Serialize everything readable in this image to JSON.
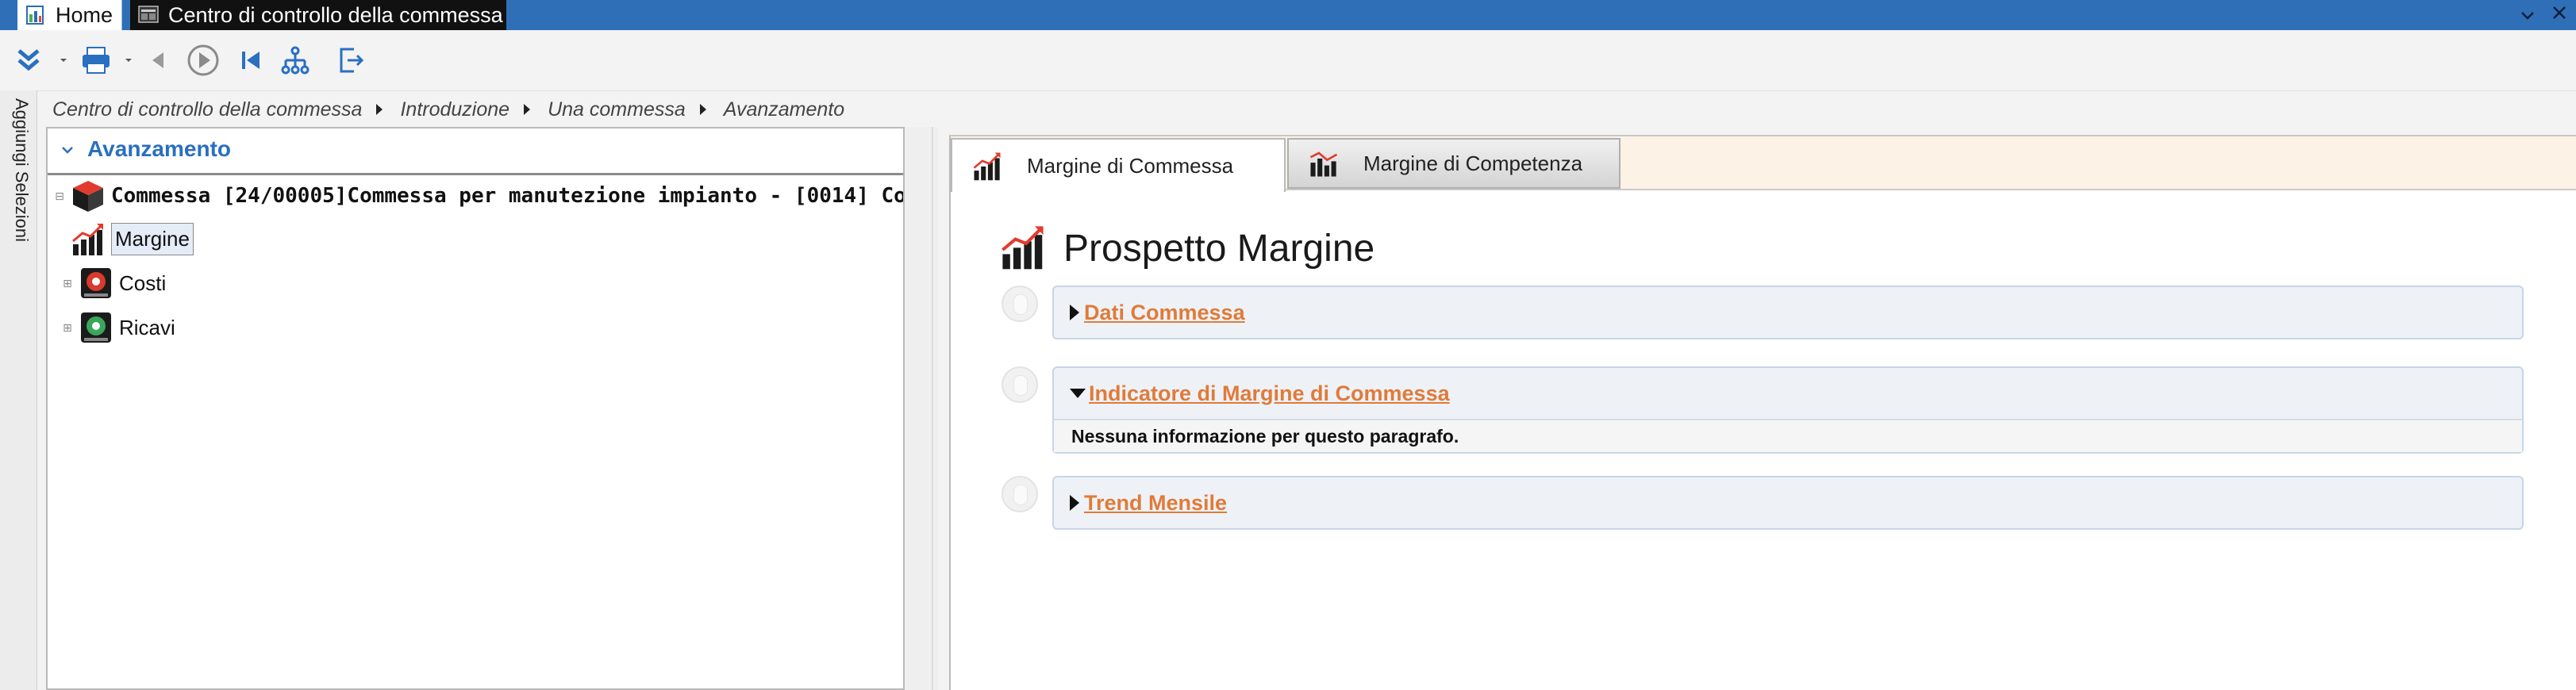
{
  "titlebar": {
    "tabs": [
      {
        "label": "Home",
        "icon": "home-app-icon"
      },
      {
        "label": "Centro di controllo della commessa",
        "icon": "control-center-icon"
      }
    ],
    "controls": [
      "chevron-down-icon",
      "close-icon"
    ],
    "color": "#2e6fb7"
  },
  "toolbar": {
    "buttons": [
      {
        "name": "collapse-button",
        "icon": "double-chevron-down-icon"
      },
      {
        "name": "print-button",
        "icon": "printer-icon"
      },
      {
        "name": "back-button",
        "icon": "triangle-left-icon"
      },
      {
        "name": "play-button",
        "icon": "play-circle-icon"
      },
      {
        "name": "first-button",
        "icon": "skip-first-icon"
      },
      {
        "name": "hierarchy-button",
        "icon": "hierarchy-icon"
      },
      {
        "name": "exit-button",
        "icon": "exit-icon"
      }
    ]
  },
  "sidebar": {
    "vertical_label": "Aggiungi Selezioni"
  },
  "breadcrumb": {
    "items": [
      "Centro di controllo della commessa",
      "Introduzione",
      "Una commessa",
      "Avanzamento"
    ]
  },
  "left_panel": {
    "title": "Avanzamento",
    "tree": {
      "root": "Commessa [24/00005]Commessa per manutezione impianto - [0014] Co",
      "children": [
        {
          "label": "Margine",
          "icon": "margin-chart-icon",
          "selected": true
        },
        {
          "label": "Costi",
          "icon": "costs-icon"
        },
        {
          "label": "Ricavi",
          "icon": "revenues-icon"
        }
      ]
    }
  },
  "right_panel": {
    "tabs": [
      {
        "label": "Margine di Commessa",
        "active": true
      },
      {
        "label": "Margine di Competenza",
        "active": false
      }
    ],
    "heading": "Prospetto Margine",
    "sections": [
      {
        "title": "Dati Commessa",
        "expanded": false
      },
      {
        "title": "Indicatore di Margine di Commessa",
        "expanded": true,
        "body": "Nessuna informazione per questo paragrafo."
      },
      {
        "title": "Trend Mensile",
        "expanded": false
      }
    ],
    "link_color": "#e07b39"
  }
}
